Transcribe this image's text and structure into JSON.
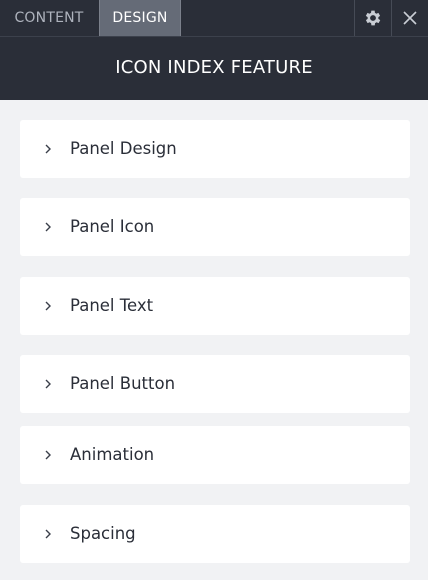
{
  "tabs": {
    "content_label": "CONTENT",
    "design_label": "DESIGN"
  },
  "icons": {
    "settings": "gear-icon",
    "close": "close-icon",
    "expand": "chevron-right-icon"
  },
  "header": {
    "title": "ICON INDEX FEATURE"
  },
  "panels": [
    {
      "label": "Panel Design"
    },
    {
      "label": "Panel Icon"
    },
    {
      "label": "Panel Text"
    },
    {
      "label": "Panel Button"
    },
    {
      "label": "Animation"
    },
    {
      "label": "Spacing"
    }
  ],
  "colors": {
    "header_bg": "#2a2e38",
    "active_tab_bg": "#656b77",
    "page_bg": "#f1f2f4",
    "panel_bg": "#ffffff"
  }
}
